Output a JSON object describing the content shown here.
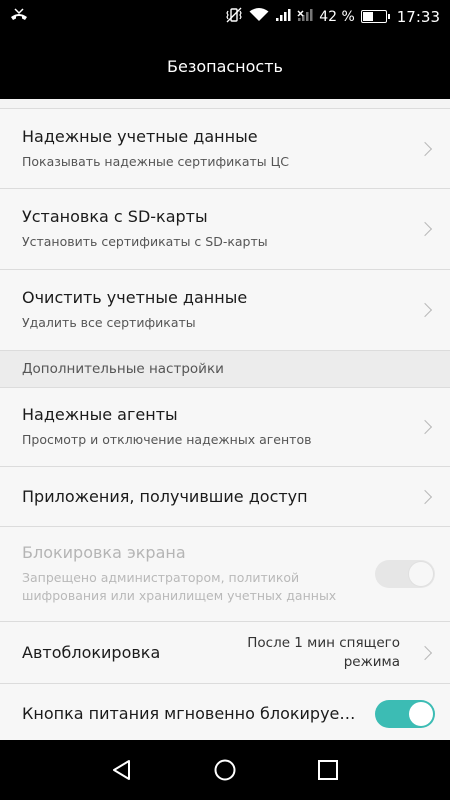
{
  "status_bar": {
    "battery_percent": "42 %",
    "time": "17:33",
    "battery_level": 0.42,
    "icons": [
      "missed-call-icon",
      "vibrate-icon",
      "wifi-icon",
      "signal-icon",
      "signal-no-sim-icon",
      "battery-icon"
    ]
  },
  "header": {
    "title": "Безопасность"
  },
  "credentials": {
    "items": [
      {
        "title": "Надежные учетные данные",
        "subtitle": "Показывать надежные сертификаты ЦС"
      },
      {
        "title": "Установка с SD-карты",
        "subtitle": "Установить сертификаты с SD-карты"
      },
      {
        "title": "Очистить учетные данные",
        "subtitle": "Удалить все сертификаты"
      }
    ]
  },
  "advanced": {
    "section_title": "Дополнительные настройки",
    "trusted_agents": {
      "title": "Надежные агенты",
      "subtitle": "Просмотр и отключение надежных агентов"
    },
    "app_access": {
      "title": "Приложения, получившие доступ"
    },
    "screen_lock": {
      "title": "Блокировка экрана",
      "subtitle": "Запрещено администратором, политикой шифрования или хранилищем учетных данных",
      "enabled": false
    },
    "auto_lock": {
      "title": "Автоблокировка",
      "value": "После 1 мин спящего режима"
    },
    "power_button": {
      "title": "Кнопка питания мгновенно блокирует…",
      "enabled": true
    }
  },
  "colors": {
    "accent": "#3cbcb4",
    "bar_background": "#000000"
  },
  "nav_bar": {
    "icons": [
      "back-icon",
      "home-icon",
      "recents-icon"
    ]
  }
}
